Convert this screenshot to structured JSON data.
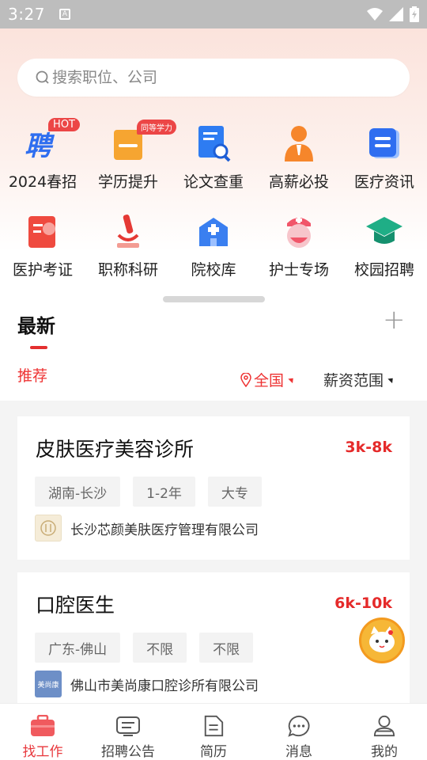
{
  "status_bar": {
    "time": "3:27",
    "a_label": "A"
  },
  "search": {
    "placeholder": "搜索职位、公司"
  },
  "shortcuts_row1": [
    {
      "label": "2024春招",
      "icon": "spring-recruit-icon",
      "badge": "HOT"
    },
    {
      "label": "学历提升",
      "icon": "education-upgrade-icon",
      "badge": "同等学力"
    },
    {
      "label": "论文查重",
      "icon": "paper-check-icon"
    },
    {
      "label": "高薪必投",
      "icon": "high-salary-icon"
    },
    {
      "label": "医疗资讯",
      "icon": "medical-news-icon"
    }
  ],
  "shortcuts_row2": [
    {
      "label": "医护考证",
      "icon": "certificate-icon"
    },
    {
      "label": "职称科研",
      "icon": "microscope-icon"
    },
    {
      "label": "院校库",
      "icon": "hospital-icon"
    },
    {
      "label": "护士专场",
      "icon": "nurse-icon"
    },
    {
      "label": "校园招聘",
      "icon": "graduation-cap-icon"
    }
  ],
  "section": {
    "title": "最新",
    "add": "+"
  },
  "filters": {
    "recommend": "推荐",
    "region": "全国",
    "salary": "薪资范围"
  },
  "jobs": [
    {
      "title": "皮肤医疗美容诊所",
      "salary": "3k-8k",
      "tags": [
        "湖南-长沙",
        "1-2年",
        "大专"
      ],
      "company": "长沙芯颜美肤医疗管理有限公司"
    },
    {
      "title": "口腔医生",
      "salary": "6k-10k",
      "tags": [
        "广东-佛山",
        "不限",
        "不限"
      ],
      "company": "佛山市美尚康口腔诊所有限公司",
      "logo_text": "美尚康"
    }
  ],
  "nav": [
    {
      "label": "找工作",
      "icon": "briefcase-icon",
      "active": true
    },
    {
      "label": "招聘公告",
      "icon": "announcement-icon"
    },
    {
      "label": "简历",
      "icon": "resume-icon"
    },
    {
      "label": "消息",
      "icon": "message-icon"
    },
    {
      "label": "我的",
      "icon": "profile-icon"
    }
  ],
  "colors": {
    "accent": "#e8383d",
    "salary": "#e52a2a"
  }
}
